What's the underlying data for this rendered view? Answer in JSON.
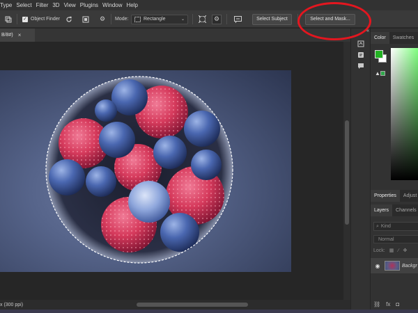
{
  "menubar": {
    "items": [
      "Type",
      "Select",
      "Filter",
      "3D",
      "View",
      "Plugins",
      "Window",
      "Help"
    ]
  },
  "optionsbar": {
    "object_finder_label": "Object Finder",
    "object_finder_checked": true,
    "mode_label": "Mode:",
    "mode_value": "Rectangle",
    "select_subject_label": "Select Subject",
    "select_and_mask_label": "Select and Mask..."
  },
  "annotation": {
    "color": "#e3161f",
    "shape": "ellipse",
    "target": "Select and Mask..."
  },
  "document": {
    "tab_name": "B/8#)",
    "close_glyph": "×"
  },
  "statusbar": {
    "text": "x (300 ppi)"
  },
  "right_panel": {
    "color_tabs": [
      "Color",
      "Swatches"
    ],
    "foreground_color": "#22b122",
    "background_color": "#ffffff",
    "properties_tabs": [
      "Properties",
      "Adjust"
    ],
    "layers_tabs": [
      "Layers",
      "Channels"
    ],
    "kind_placeholder": "Kind",
    "blend_mode": "Normal",
    "lock_label": "Lock:",
    "layer_name": "Backgr"
  },
  "photo": {
    "subject": "bowl of raspberries and blueberries",
    "selection": "circular marching ants around bowl"
  }
}
